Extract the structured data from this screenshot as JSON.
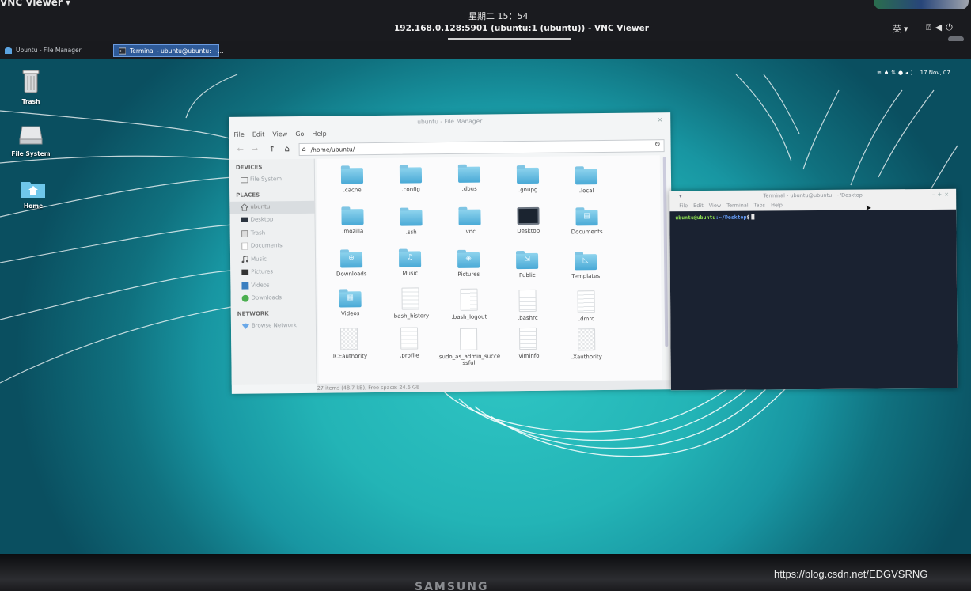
{
  "host": {
    "app_menu": "VNC Viewer ▾",
    "clock": "星期二 15：54",
    "window_title": "192.168.0.128:5901 (ubuntu:1 (ubuntu)) - VNC Viewer",
    "ime": "英 ▾",
    "icons": [
      "accessibility-icon",
      "volume-icon",
      "power-icon"
    ]
  },
  "taskbar": {
    "tasks": [
      {
        "label": "Ubuntu - File Manager",
        "icon": "folder-icon",
        "active": false
      },
      {
        "label": "Terminal - ubuntu@ubuntu: ~...",
        "icon": "terminal-icon",
        "active": true
      }
    ]
  },
  "tray": {
    "icons": [
      "wifi-icon",
      "bell-icon",
      "network-icon",
      "dropbox-icon",
      "volume-icon"
    ],
    "datetime": "17 Nov, 07"
  },
  "desktop_icons": [
    {
      "label": "Trash",
      "icon": "trash-icon"
    },
    {
      "label": "File System",
      "icon": "drive-icon"
    },
    {
      "label": "Home",
      "icon": "home-folder-icon"
    }
  ],
  "file_manager": {
    "title": "ubuntu - File Manager",
    "menu": [
      "File",
      "Edit",
      "View",
      "Go",
      "Help"
    ],
    "location": "/home/ubuntu/",
    "sidebar": {
      "devices_heading": "DEVICES",
      "devices": [
        {
          "label": "File System",
          "icon": "drive-icon"
        }
      ],
      "places_heading": "PLACES",
      "places": [
        {
          "label": "ubuntu",
          "icon": "home-icon"
        },
        {
          "label": "Desktop",
          "icon": "desktop-icon"
        },
        {
          "label": "Trash",
          "icon": "trash-icon"
        },
        {
          "label": "Documents",
          "icon": "documents-icon"
        },
        {
          "label": "Music",
          "icon": "music-icon"
        },
        {
          "label": "Pictures",
          "icon": "pictures-icon"
        },
        {
          "label": "Videos",
          "icon": "videos-icon"
        },
        {
          "label": "Downloads",
          "icon": "downloads-icon"
        }
      ],
      "network_heading": "NETWORK",
      "network": [
        {
          "label": "Browse Network",
          "icon": "network-icon"
        }
      ]
    },
    "items": [
      {
        "name": ".cache",
        "kind": "folder"
      },
      {
        "name": ".config",
        "kind": "folder"
      },
      {
        "name": ".dbus",
        "kind": "folder"
      },
      {
        "name": ".gnupg",
        "kind": "folder"
      },
      {
        "name": ".local",
        "kind": "folder"
      },
      {
        "name": ".mozilla",
        "kind": "folder"
      },
      {
        "name": ".ssh",
        "kind": "folder"
      },
      {
        "name": ".vnc",
        "kind": "folder"
      },
      {
        "name": "Desktop",
        "kind": "desktop"
      },
      {
        "name": "Documents",
        "kind": "folder",
        "glyph": "▤"
      },
      {
        "name": "Downloads",
        "kind": "folder",
        "glyph": "⊕"
      },
      {
        "name": "Music",
        "kind": "folder",
        "glyph": "♫"
      },
      {
        "name": "Pictures",
        "kind": "folder",
        "glyph": "◈"
      },
      {
        "name": "Public",
        "kind": "folder",
        "glyph": "⇲"
      },
      {
        "name": "Templates",
        "kind": "folder",
        "glyph": "◺"
      },
      {
        "name": "Videos",
        "kind": "folder",
        "glyph": "▦"
      },
      {
        "name": ".bash_history",
        "kind": "text"
      },
      {
        "name": ".bash_logout",
        "kind": "text"
      },
      {
        "name": ".bashrc",
        "kind": "text"
      },
      {
        "name": ".dmrc",
        "kind": "text"
      },
      {
        "name": ".ICEauthority",
        "kind": "binary"
      },
      {
        "name": ".profile",
        "kind": "text"
      },
      {
        "name": ".sudo_as_admin_successful",
        "kind": "blank"
      },
      {
        "name": ".viminfo",
        "kind": "text"
      },
      {
        "name": ".Xauthority",
        "kind": "binary"
      }
    ],
    "status": "27 items (48.7 kB), Free space: 24.6 GB"
  },
  "terminal": {
    "title": "Terminal - ubuntu@ubuntu: ~/Desktop",
    "menu": [
      "File",
      "Edit",
      "View",
      "Terminal",
      "Tabs",
      "Help"
    ],
    "prompt_user": "ubuntu@ubuntu",
    "prompt_path": ":~/Desktop",
    "prompt_symbol": "$"
  },
  "monitor_brand": "SAMSUNG",
  "watermark": "https://blog.csdn.net/EDGVSRNG"
}
